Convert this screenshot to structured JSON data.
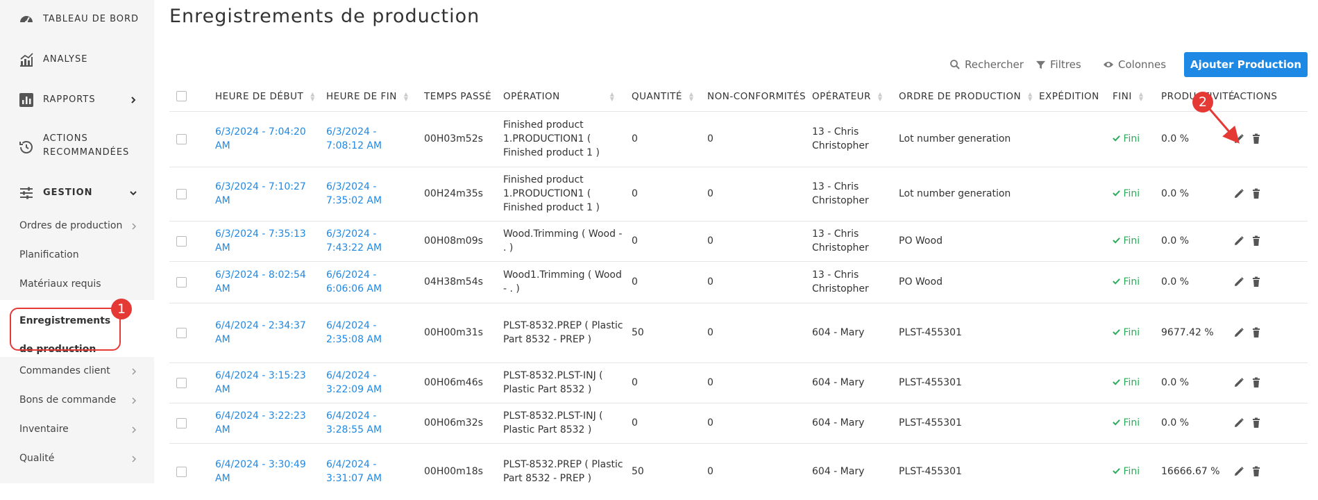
{
  "sidebar": {
    "main_items": [
      {
        "label": "TABLEAU DE BORD",
        "icon": "dashboard-gauge-icon"
      },
      {
        "label": "ANALYSE",
        "icon": "analytics-chart-icon"
      },
      {
        "label": "RAPPORTS",
        "icon": "reports-chart-icon"
      },
      {
        "label": "ACTIONS RECOMMANDÉES",
        "icon": "history-clock-icon"
      },
      {
        "label": "GESTION",
        "icon": "sliders-icon"
      }
    ],
    "sub_items": [
      {
        "label": "Ordres de production"
      },
      {
        "label": "Planification"
      },
      {
        "label": "Matériaux requis"
      },
      {
        "label": "Commandes client"
      },
      {
        "label": "Bons de commande"
      },
      {
        "label": "Inventaire"
      },
      {
        "label": "Qualité"
      }
    ],
    "active_item": "Enregistrements de production",
    "badge_1": "1"
  },
  "header": {
    "title": "Enregistrements de production",
    "search_label": "Rechercher",
    "filters_label": "Filtres",
    "columns_label": "Colonnes",
    "add_button": "Ajouter Production",
    "accent_color": "#1e88e5",
    "badge_2": "2"
  },
  "table": {
    "columns": [
      "HEURE DE DÉBUT",
      "HEURE DE FIN",
      "TEMPS PASSÉ",
      "OPÉRATION",
      "QUANTITÉ",
      "NON-CONFORMITÉS",
      "OPÉRATEUR",
      "ORDRE DE PRODUCTION",
      "EXPÉDITION",
      "FINI",
      "PRODUCTIVITÉ",
      "ACTIONS"
    ],
    "rows": [
      {
        "start": "6/3/2024 - 7:04:20 AM",
        "end": "6/3/2024 - 7:08:12 AM",
        "spent": "00H03m52s",
        "operation": "Finished product 1.PRODUCTION1 ( Finished product 1 )",
        "qty": "0",
        "nc": "0",
        "operator": "13 - Chris Christopher",
        "order": "Lot number generation",
        "expedition": "",
        "fini": "Fini",
        "productivity": "0.0 %"
      },
      {
        "start": "6/3/2024 - 7:10:27 AM",
        "end": "6/3/2024 - 7:35:02 AM",
        "spent": "00H24m35s",
        "operation": "Finished product 1.PRODUCTION1 ( Finished product 1 )",
        "qty": "0",
        "nc": "0",
        "operator": "13 - Chris Christopher",
        "order": "Lot number generation",
        "expedition": "",
        "fini": "Fini",
        "productivity": "0.0 %"
      },
      {
        "start": "6/3/2024 - 7:35:13 AM",
        "end": "6/3/2024 - 7:43:22 AM",
        "spent": "00H08m09s",
        "operation": "Wood.Trimming ( Wood - . )",
        "qty": "0",
        "nc": "0",
        "operator": "13 - Chris Christopher",
        "order": "PO Wood",
        "expedition": "",
        "fini": "Fini",
        "productivity": "0.0 %"
      },
      {
        "start": "6/3/2024 - 8:02:54 AM",
        "end": "6/6/2024 - 6:06:06 AM",
        "spent": "04H38m54s",
        "operation": "Wood1.Trimming ( Wood - . )",
        "qty": "0",
        "nc": "0",
        "operator": "13 - Chris Christopher",
        "order": "PO Wood",
        "expedition": "",
        "fini": "Fini",
        "productivity": "0.0 %"
      },
      {
        "start": "6/4/2024 - 2:34:37 AM",
        "end": "6/4/2024 - 2:35:08 AM",
        "spent": "00H00m31s",
        "operation": "PLST-8532.PREP ( Plastic Part 8532 - PREP )",
        "qty": "50",
        "nc": "0",
        "operator": "604 - Mary",
        "order": "PLST-455301",
        "expedition": "",
        "fini": "Fini",
        "productivity": "9677.42 %"
      },
      {
        "start": "6/4/2024 - 3:15:23 AM",
        "end": "6/4/2024 - 3:22:09 AM",
        "spent": "00H06m46s",
        "operation": "PLST-8532.PLST-INJ ( Plastic Part 8532 )",
        "qty": "0",
        "nc": "0",
        "operator": "604 - Mary",
        "order": "PLST-455301",
        "expedition": "",
        "fini": "Fini",
        "productivity": "0.0 %"
      },
      {
        "start": "6/4/2024 - 3:22:23 AM",
        "end": "6/4/2024 - 3:28:55 AM",
        "spent": "00H06m32s",
        "operation": "PLST-8532.PLST-INJ ( Plastic Part 8532 )",
        "qty": "0",
        "nc": "0",
        "operator": "604 - Mary",
        "order": "PLST-455301",
        "expedition": "",
        "fini": "Fini",
        "productivity": "0.0 %"
      },
      {
        "start": "6/4/2024 - 3:30:49 AM",
        "end": "6/4/2024 - 3:31:07 AM",
        "spent": "00H00m18s",
        "operation": "PLST-8532.PREP ( Plastic Part 8532 - PREP )",
        "qty": "50",
        "nc": "0",
        "operator": "604 - Mary",
        "order": "PLST-455301",
        "expedition": "",
        "fini": "Fini",
        "productivity": "16666.67 %"
      }
    ]
  }
}
